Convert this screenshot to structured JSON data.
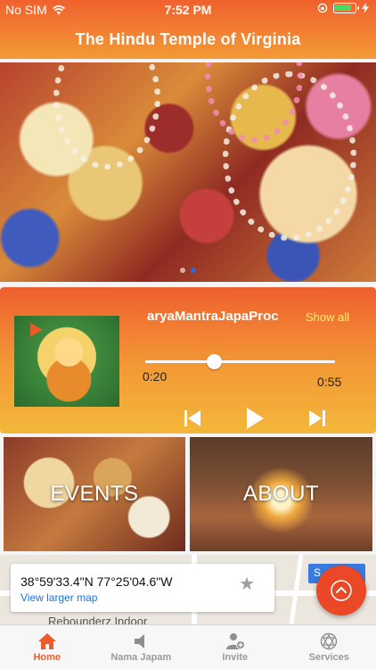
{
  "status_bar": {
    "carrier": "No SIM",
    "time": "7:52 PM"
  },
  "header": {
    "title": "The Hindu Temple of Virginia"
  },
  "hero": {
    "slide_count": 2,
    "active_slide": 2
  },
  "player": {
    "track_title": "aryaMantraJapaProc",
    "show_all_label": "Show all",
    "elapsed": "0:20",
    "total": "0:55",
    "progress": 0.36
  },
  "tiles": [
    {
      "label": "EVENTS"
    },
    {
      "label": "ABOUT"
    }
  ],
  "map": {
    "coordinates": "38°59'33.4\"N 77°25'04.6\"W",
    "view_larger_label": "View larger map",
    "poi_label": "Rebounderz Indoor"
  },
  "tabbar": {
    "items": [
      {
        "label": "Home",
        "icon": "home-icon",
        "active": true
      },
      {
        "label": "Nama Japam",
        "icon": "speaker-icon",
        "active": false
      },
      {
        "label": "Invite",
        "icon": "add-user-icon",
        "active": false
      },
      {
        "label": "Services",
        "icon": "chakra-icon",
        "active": false
      }
    ]
  },
  "colors": {
    "accent": "#ef5a2a",
    "header_top": "#f0612e",
    "header_bottom": "#f39a36",
    "show_all": "#fff36a",
    "link": "#1a73e8",
    "fab": "#ea4826"
  }
}
